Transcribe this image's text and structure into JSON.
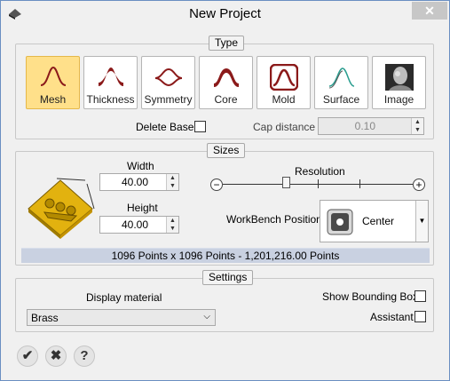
{
  "window": {
    "title": "New Project",
    "close_glyph": "✕"
  },
  "type_group": {
    "label": "Type",
    "buttons": [
      {
        "label": "Mesh",
        "selected": true,
        "icon": "mesh-icon"
      },
      {
        "label": "Thickness",
        "selected": false,
        "icon": "thickness-icon"
      },
      {
        "label": "Symmetry",
        "selected": false,
        "icon": "symmetry-icon"
      },
      {
        "label": "Core",
        "selected": false,
        "icon": "core-icon"
      },
      {
        "label": "Mold",
        "selected": false,
        "icon": "mold-icon"
      },
      {
        "label": "Surface",
        "selected": false,
        "icon": "surface-icon"
      },
      {
        "label": "Image",
        "selected": false,
        "icon": "image-icon"
      }
    ],
    "delete_base_label": "Delete Base",
    "delete_base_checked": false,
    "cap_distance_label": "Cap distance",
    "cap_distance_value": "0.10"
  },
  "sizes_group": {
    "label": "Sizes",
    "width_label": "Width",
    "width_value": "40.00",
    "height_label": "Height",
    "height_value": "40.00",
    "resolution_label": "Resolution",
    "workbench_label": "WorkBench Position",
    "workbench_value": "Center",
    "points_summary": "1096 Points x 1096 Points - 1,201,216.00 Points"
  },
  "settings_group": {
    "label": "Settings",
    "display_material_label": "Display material",
    "display_material_value": "Brass",
    "show_bounding_box_label": "Show Bounding Box",
    "show_bounding_box_checked": false,
    "assistant_label": "Assistant",
    "assistant_checked": false
  },
  "footer": {
    "ok_glyph": "✔",
    "cancel_glyph": "✖",
    "help_glyph": "?"
  },
  "colors": {
    "accent": "#8b1a1a",
    "selected_bg": "#ffe08a",
    "surface_icon": "#2a9d8f",
    "preview_gold": "#e2b20f"
  }
}
